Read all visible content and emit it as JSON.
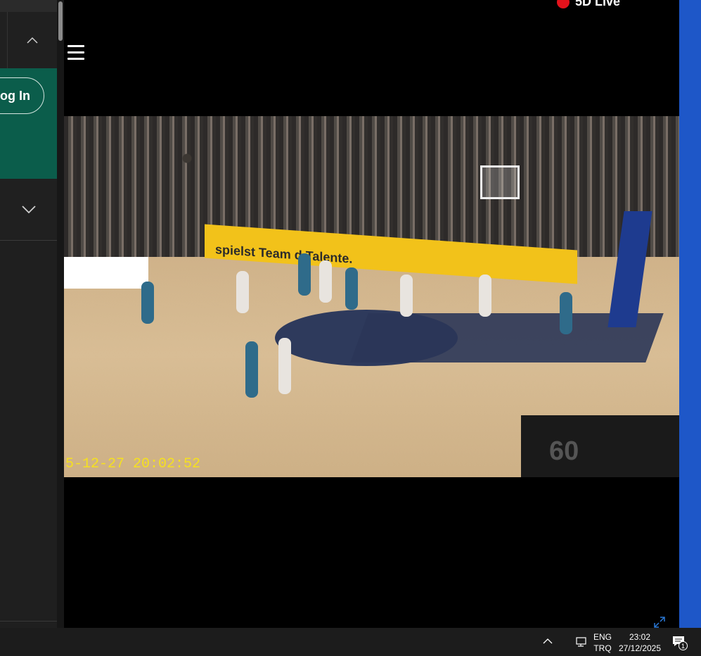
{
  "sidebar": {
    "login_label": "og In"
  },
  "player": {
    "live_label": "5D Live",
    "menu_icon": "hamburger-icon",
    "video": {
      "timestamp": "5-12-27 20:02:52",
      "banner_text": "spielst     Team   d Talente.",
      "scoreboard_text": "60"
    }
  },
  "taskbar": {
    "lang_top": "ENG",
    "lang_bottom": "TRQ",
    "time": "23:02",
    "date": "27/12/2025",
    "notification_count": "1"
  },
  "colors": {
    "accent_green": "#0b5d4b",
    "live_red": "#e3121b",
    "timestamp_yellow": "#f5e020",
    "right_blue": "#1e57c8"
  }
}
